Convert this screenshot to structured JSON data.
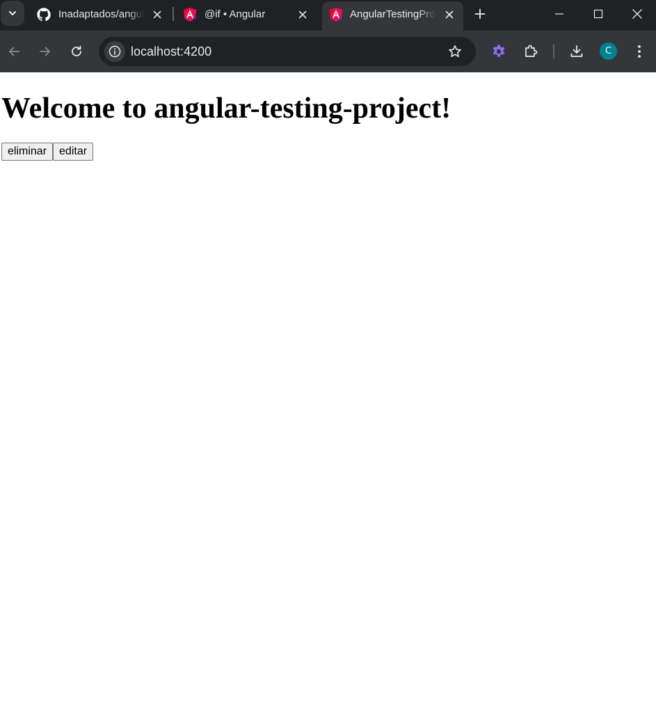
{
  "browser": {
    "tabs": [
      {
        "title": "Inadaptados/angular-testing-project",
        "favicon": "github-icon",
        "active": false
      },
      {
        "title": "@if • Angular",
        "favicon": "angular-icon",
        "active": false
      },
      {
        "title": "AngularTestingProject",
        "favicon": "angular-icon",
        "active": true
      }
    ],
    "address": "localhost:4200",
    "profile_initial": "C",
    "colors": {
      "frame": "#202124",
      "toolbar": "#35363a",
      "extension_accent": "#8e6cf0",
      "avatar": "#00838f",
      "angular_magenta": "#e0147d"
    }
  },
  "page": {
    "heading": "Welcome to angular-testing-project!",
    "buttons": {
      "delete_label": "eliminar",
      "edit_label": "editar"
    }
  }
}
